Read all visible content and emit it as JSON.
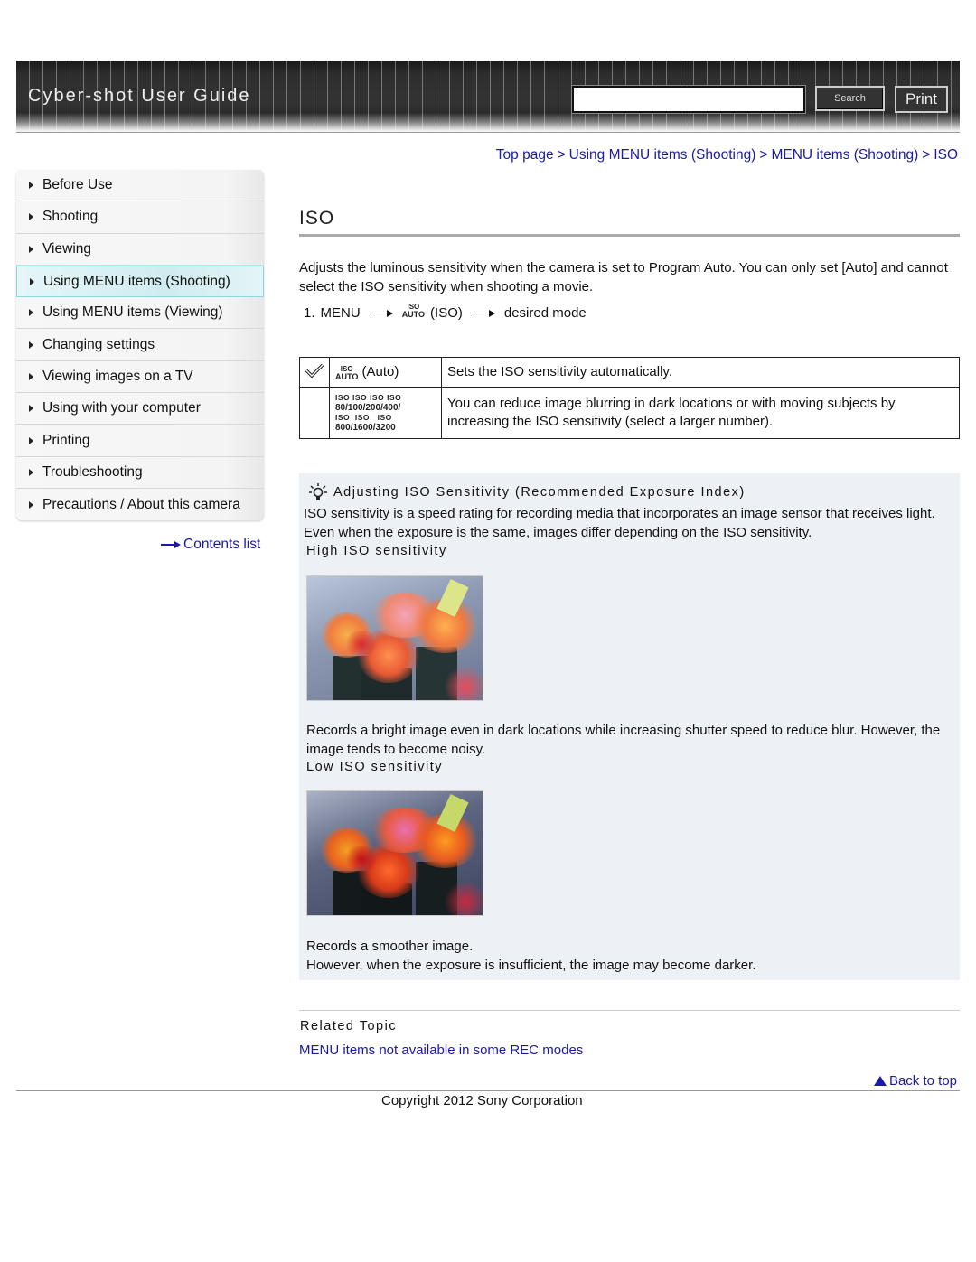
{
  "header": {
    "site_title": "Cyber-shot User Guide",
    "search_placeholder": "",
    "search_value": "",
    "search_button": "Search",
    "print_button": "Print"
  },
  "sidebar": {
    "items": [
      {
        "label": "Before Use",
        "active": false
      },
      {
        "label": "Shooting",
        "active": false
      },
      {
        "label": "Viewing",
        "active": false
      },
      {
        "label": "Using MENU items (Shooting)",
        "active": true
      },
      {
        "label": "Using MENU items (Viewing)",
        "active": false
      },
      {
        "label": "Changing settings",
        "active": false
      },
      {
        "label": "Viewing images on a TV",
        "active": false
      },
      {
        "label": "Using with your computer",
        "active": false
      },
      {
        "label": "Printing",
        "active": false
      },
      {
        "label": "Troubleshooting",
        "active": false
      },
      {
        "label": "Precautions / About this camera",
        "active": false
      }
    ],
    "contents_link": "Contents list"
  },
  "breadcrumb": {
    "items": [
      "Top page",
      "Using MENU items (Shooting)",
      "MENU items (Shooting)",
      "ISO"
    ],
    "separator": ">"
  },
  "main": {
    "title": "ISO",
    "intro": "Adjusts the luminous sensitivity when the camera is set to Program Auto. You can only set [Auto] and cannot select the ISO sensitivity when shooting a movie.",
    "step": {
      "number": "1.",
      "menu": "MENU",
      "icon_top": "ISO",
      "icon_bottom": "AUTO",
      "iso_label": "(ISO)",
      "target": "desired mode"
    },
    "table": {
      "rows": [
        {
          "default": true,
          "icon_top": "ISO",
          "icon_bottom": "AUTO",
          "mode_label": "(Auto)",
          "description": "Sets the ISO sensitivity automatically."
        },
        {
          "default": false,
          "iso_values_line1": [
            "80",
            "100",
            "200",
            "400"
          ],
          "iso_values_line2": [
            "800",
            "1600",
            "3200"
          ],
          "iso_prefix": "ISO",
          "description": "You can reduce image blurring in dark locations or with moving subjects by increasing the ISO sensitivity (select a larger number)."
        }
      ]
    },
    "hint": {
      "title": "Adjusting ISO Sensitivity (Recommended Exposure Index)",
      "body": "ISO sensitivity is a speed rating for recording media that incorporates an image sensor that receives light. Even when the exposure is the same, images differ depending on the ISO sensitivity.",
      "high": {
        "heading": "High ISO sensitivity",
        "image_alt": "Flowers in buckets photographed at high ISO",
        "text": "Records a bright image even in dark locations while increasing shutter speed to reduce blur. However, the image tends to become noisy."
      },
      "low": {
        "heading": "Low ISO sensitivity",
        "image_alt": "Flowers in buckets photographed at low ISO",
        "text_line1": "Records a smoother image.",
        "text_line2": "However, when the exposure is insufficient, the image may become darker."
      }
    },
    "related": {
      "title": "Related Topic",
      "link": "MENU items not available in some REC modes"
    },
    "back_to_top": "Back to top"
  },
  "footer": {
    "copyright": "Copyright 2012 Sony Corporation"
  },
  "colors": {
    "link": "#1a1aa6",
    "hint_bg": "#edf0f5",
    "active_nav": "#d0ecf0"
  }
}
